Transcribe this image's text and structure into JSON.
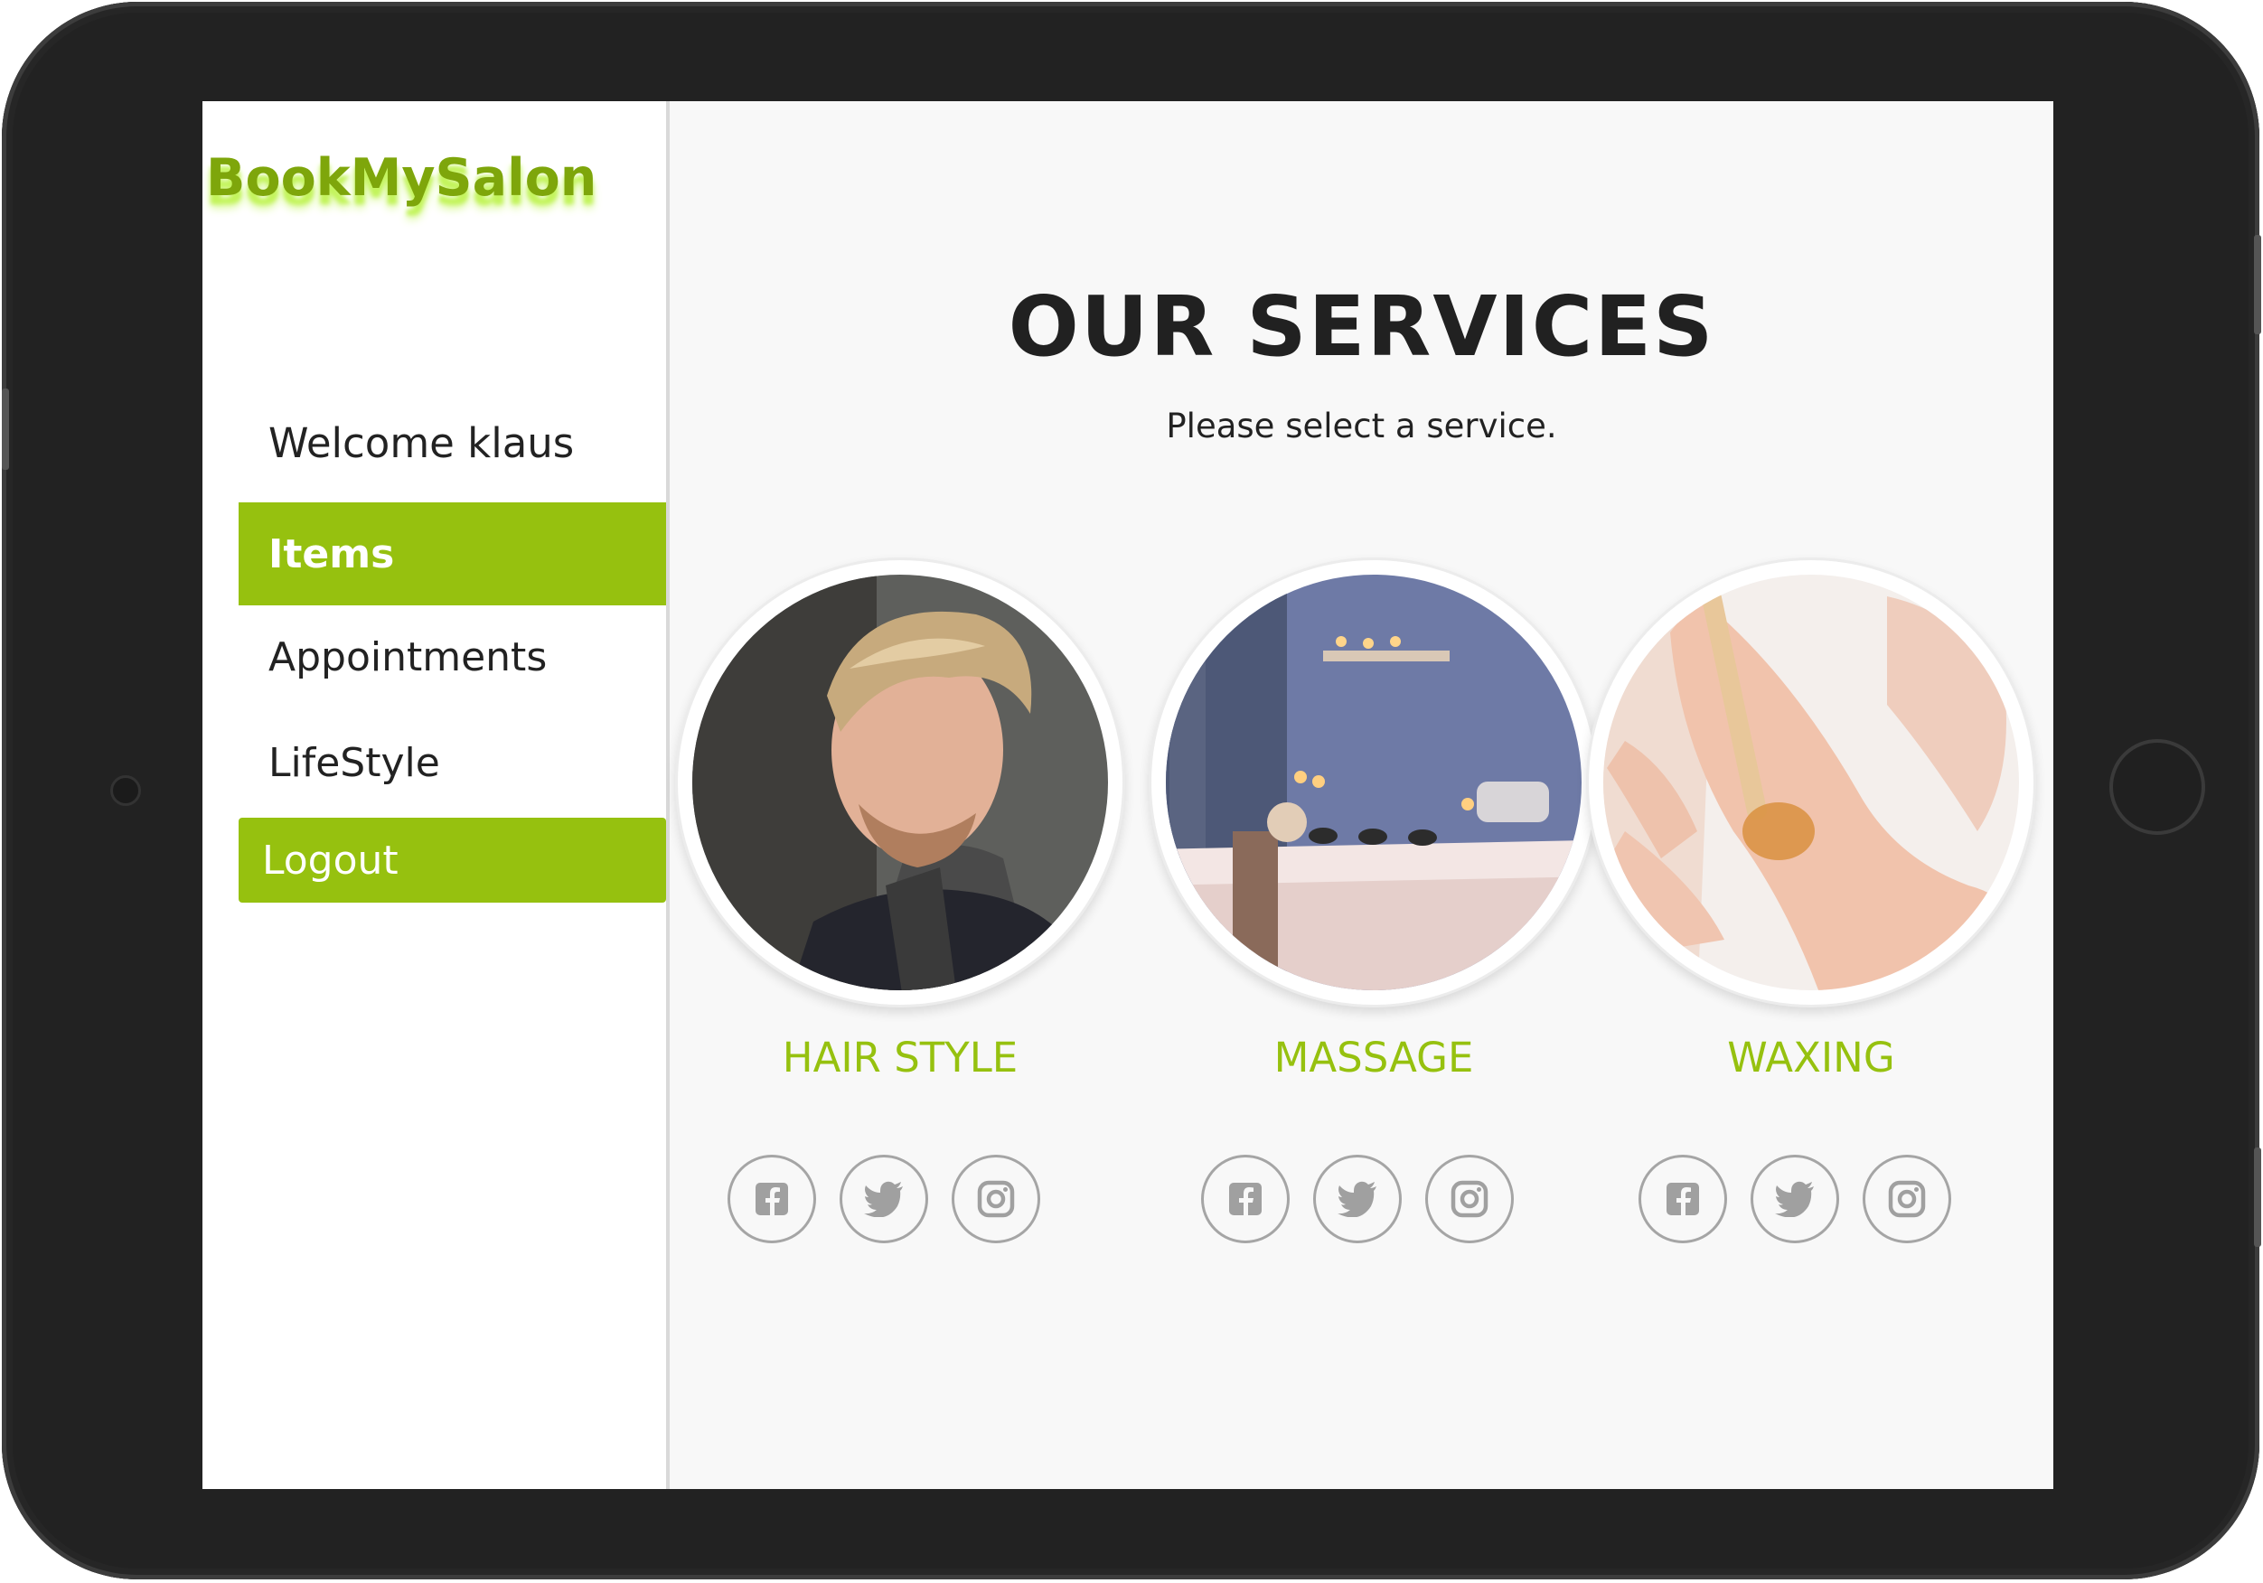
{
  "app": {
    "brand": "BookMySalon"
  },
  "sidebar": {
    "welcome": "Welcome klaus",
    "items": [
      {
        "label": "Items",
        "active": true
      },
      {
        "label": "Appointments",
        "active": false
      },
      {
        "label": "LifeStyle",
        "active": false
      }
    ],
    "logout_label": "Logout"
  },
  "main": {
    "title": "OUR SERVICES",
    "subtitle": "Please select a service.",
    "services": [
      {
        "name": "HAIR STYLE",
        "image": "man-hairstyle-photo",
        "social": [
          "facebook-icon",
          "twitter-icon",
          "instagram-icon"
        ]
      },
      {
        "name": "MASSAGE",
        "image": "massage-room-photo",
        "social": [
          "facebook-icon",
          "twitter-icon",
          "instagram-icon"
        ]
      },
      {
        "name": "WAXING",
        "image": "leg-waxing-photo",
        "social": [
          "facebook-icon",
          "twitter-icon",
          "instagram-icon"
        ]
      }
    ]
  },
  "colors": {
    "accent": "#96c10f",
    "brand": "#7ea60b",
    "frame": "#222222",
    "screen_bg": "#f8f8f8",
    "social_icon": "#a0a0a0"
  }
}
